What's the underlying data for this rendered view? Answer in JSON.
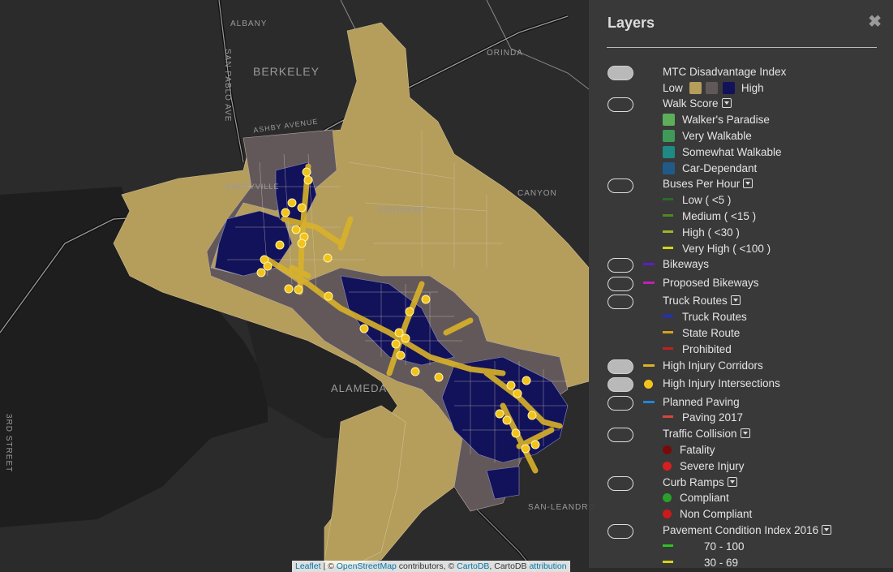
{
  "colors": {
    "low": "#b59d5c",
    "mid": "#62585a",
    "high": "#12125a",
    "corridor": "#d9b22a",
    "intersection": "#f2c41a",
    "walkers_paradise": "#5cae5b",
    "very_walkable": "#3f9a5a",
    "somewhat_walkable": "#1f8a84",
    "car_dependant": "#1f5b86",
    "bus_low": "#2c6a2c",
    "bus_medium": "#4a8a24",
    "bus_high": "#9ab62e",
    "bus_very_high": "#d6d21a",
    "bikeways": "#5a1fc8",
    "proposed_bikeways": "#c41fb2",
    "truck_routes": "#1a2fd6",
    "state_route": "#d6a11a",
    "prohibited": "#c41f1f",
    "planned_paving": "#1f86d6",
    "paving_2017": "#d6463a",
    "fatality": "#7a0a0a",
    "severe_injury": "#d81f1f",
    "compliant": "#2aa02a",
    "non_compliant": "#cc1a1a",
    "pci_70_100": "#2ac41f",
    "pci_30_69": "#d6d21a"
  },
  "map": {
    "places": [
      "ALBANY",
      "BERKELEY",
      "SAN PABLO AVE",
      "ORINDA",
      "EMERYVILLE",
      "PIEDMONT",
      "CANYON",
      "ALAMEDA",
      "SAN-LEANDRO",
      "ASHBY AVENUE",
      "3RD STREET"
    ],
    "attribution": {
      "leaflet": "Leaflet",
      "sep1": " | © ",
      "osm": "OpenStreetMap",
      "contrib": " contributors, © ",
      "cartodb": "CartoDB",
      "sep2": ", CartoDB ",
      "attr": "attribution"
    }
  },
  "panel": {
    "title": "Layers",
    "close": "✖",
    "mtc": {
      "label": "MTC Disadvantage Index",
      "low": "Low",
      "high": "High"
    },
    "walk": {
      "label": "Walk Score",
      "items": [
        "Walker's Paradise",
        "Very Walkable",
        "Somewhat Walkable",
        "Car-Dependant"
      ]
    },
    "buses": {
      "label": "Buses Per Hour",
      "items": [
        "Low ( <5 )",
        "Medium ( <15 )",
        "High ( <30 )",
        "Very High ( <100 )"
      ]
    },
    "bikeways": "Bikeways",
    "proposed_bikeways": "Proposed Bikeways",
    "truck": {
      "label": "Truck Routes",
      "items": [
        "Truck Routes",
        "State Route",
        "Prohibited"
      ]
    },
    "hi_corridors": "High Injury Corridors",
    "hi_intersections": "High Injury Intersections",
    "paving": {
      "label": "Planned Paving",
      "items": [
        "Paving 2017"
      ]
    },
    "collision": {
      "label": "Traffic Collision",
      "items": [
        "Fatality",
        "Severe Injury"
      ]
    },
    "ramps": {
      "label": "Curb Ramps",
      "items": [
        "Compliant",
        "Non Compliant"
      ]
    },
    "pci": {
      "label": "Pavement Condition Index 2016",
      "items": [
        "70 - 100",
        "30 - 69"
      ]
    }
  }
}
